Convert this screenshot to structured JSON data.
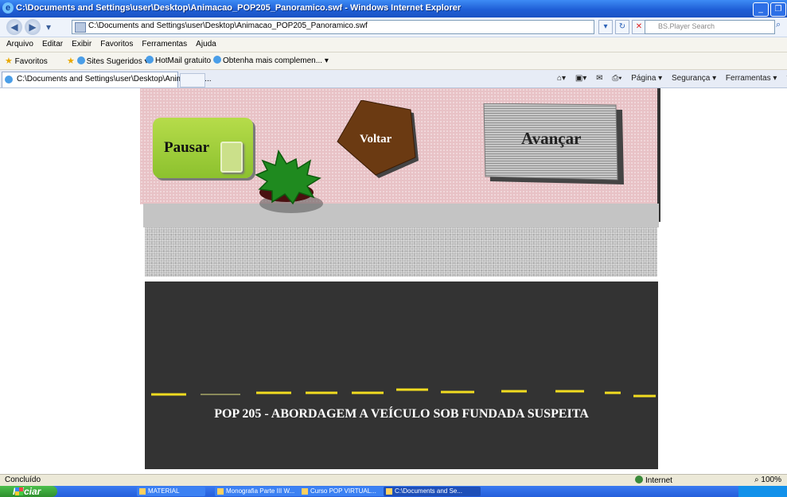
{
  "window": {
    "title": "C:\\Documents and Settings\\user\\Desktop\\Animacao_POP205_Panoramico.swf - Windows Internet Explorer"
  },
  "address_bar": {
    "url": "C:\\Documents and Settings\\user\\Desktop\\Animacao_POP205_Panoramico.swf",
    "search_placeholder": "BS.Player Search"
  },
  "menu": {
    "items": [
      "Arquivo",
      "Editar",
      "Exibir",
      "Favoritos",
      "Ferramentas",
      "Ajuda"
    ]
  },
  "favorites_bar": {
    "favorites_label": "Favoritos",
    "links": [
      "Sites Sugeridos ▾",
      "HotMail gratuito",
      "Obtenha mais complemen... ▾"
    ]
  },
  "tabs": {
    "active_label": "C:\\Documents and Settings\\user\\Desktop\\Animacao_...",
    "command_bar": [
      "Página ▾",
      "Segurança ▾",
      "Ferramentas ▾"
    ]
  },
  "animation": {
    "pause_label": "Pausar",
    "back_label": "Voltar",
    "next_label": "Avançar",
    "road_title": "POP 205 - ABORDAGEM A VEÍCULO SOB FUNDADA SUSPEITA",
    "colors": {
      "stage_pink": "#e8c2c6",
      "pause_green": "#9ccf3a",
      "back_brown": "#6b3a12",
      "road": "#333333",
      "lane_yellow": "#f2dc20",
      "plant_green": "#1f8a1f"
    }
  },
  "status_bar": {
    "status": "Concluído",
    "zone": "Internet",
    "zoom": "100%"
  },
  "taskbar": {
    "start_label": "Iniciar",
    "tasks": [
      "MATERIAL",
      "Monografia Parte III W...",
      "Curso POP VIRTUAL...",
      "C:\\Documents and Se..."
    ]
  }
}
